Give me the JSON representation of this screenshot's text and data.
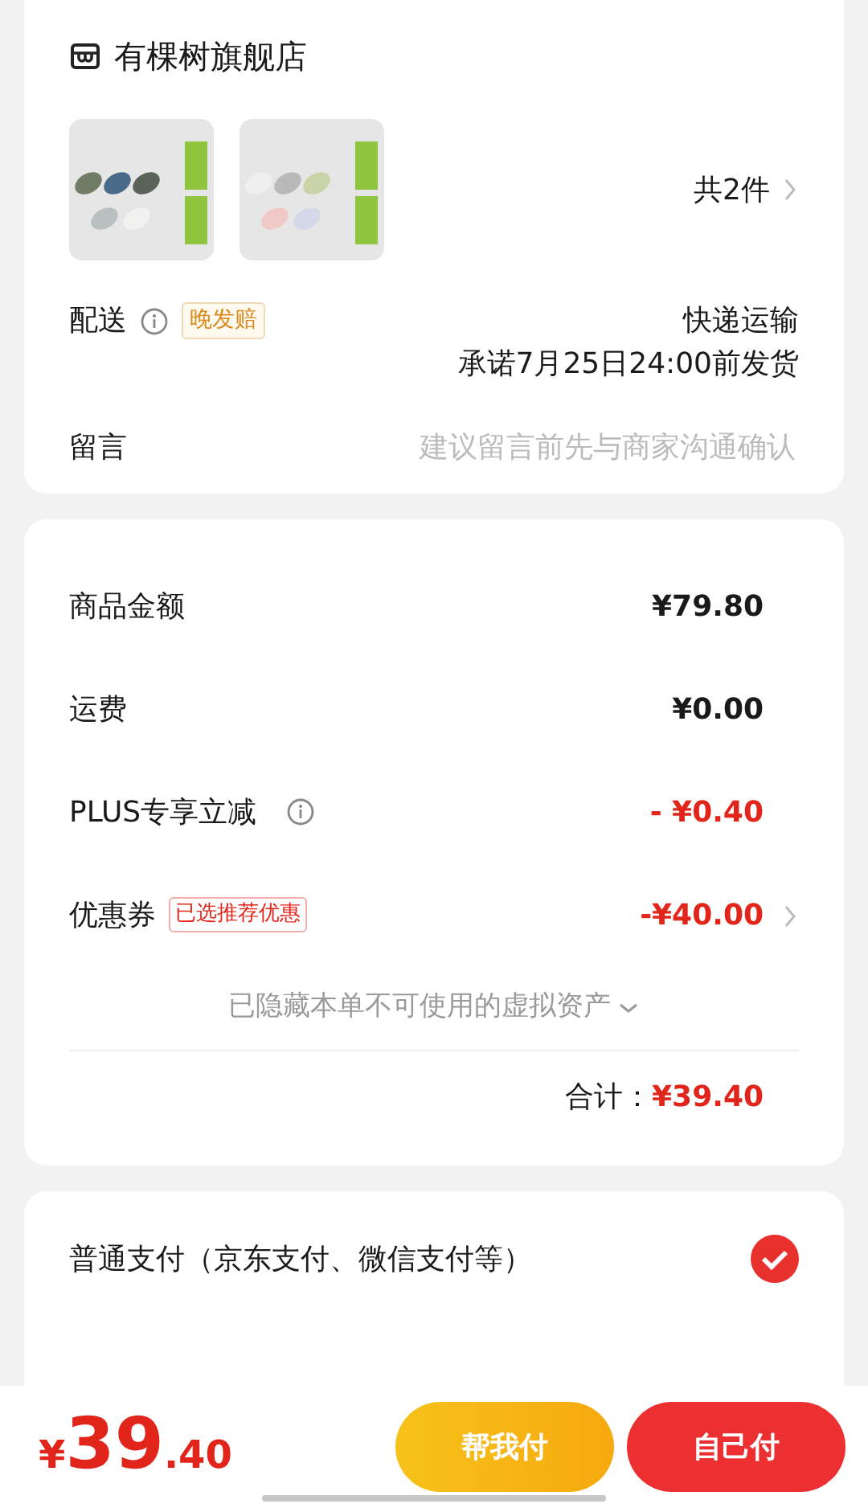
{
  "store": {
    "name": "有棵树旗舰店"
  },
  "products": {
    "count": "共2件"
  },
  "delivery": {
    "label": "配送",
    "tag": "晚发赔",
    "method": "快递运输",
    "promise": "承诺7月25日24:00前发货"
  },
  "message": {
    "label": "留言",
    "placeholder": "建议留言前先与商家沟通确认"
  },
  "costs": {
    "rows": [
      {
        "label": "商品金额",
        "amount": "¥79.80",
        "kind": "plain"
      },
      {
        "label": "运费",
        "amount": "¥0.00",
        "kind": "plain"
      },
      {
        "label": "PLUS专享立减",
        "info": true,
        "amount": "- ¥0.40",
        "kind": "discount"
      },
      {
        "label": "优惠券",
        "tag": "已选推荐优惠",
        "amount": "-¥40.00",
        "kind": "discount",
        "chevron": true
      }
    ],
    "hidden_note": "已隐藏本单不可使用的虚拟资产",
    "total_label": "合计：",
    "total": "¥39.40"
  },
  "payment": {
    "options": [
      {
        "label": "普通支付（京东支付、微信支付等）",
        "selected": true
      }
    ]
  },
  "bottom_bar": {
    "currency": "¥",
    "integer": "39",
    "decimal": ".40",
    "buttons": [
      {
        "label": "帮我付",
        "kind": "secondary"
      },
      {
        "label": "自己付",
        "kind": "primary"
      }
    ]
  }
}
